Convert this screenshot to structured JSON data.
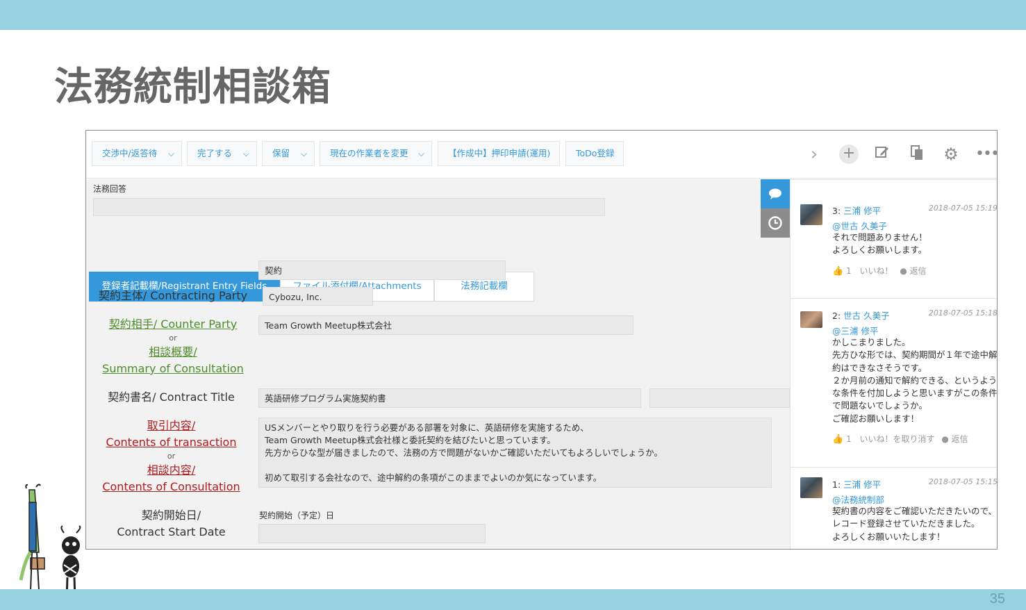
{
  "slide": {
    "title": "法務統制相談箱",
    "page_number": "35"
  },
  "toolbar": {
    "buttons": [
      {
        "label": "交渉中/返答待",
        "has_dropdown": true
      },
      {
        "label": "完了する",
        "has_dropdown": true
      },
      {
        "label": "保留",
        "has_dropdown": true
      },
      {
        "label": "現在の作業者を変更",
        "has_dropdown": true
      },
      {
        "label": "【作成中】押印申請(運用)",
        "has_dropdown": false
      },
      {
        "label": "ToDo登録",
        "has_dropdown": false
      }
    ],
    "icons": [
      "chevron-right-icon",
      "plus-icon",
      "edit-icon",
      "copy-icon",
      "gear-icon",
      "more-icon"
    ]
  },
  "form": {
    "legal_answer_label": "法務回答",
    "legal_answer_value": "",
    "tabs": [
      {
        "label": "登録者記載欄/Registrant Entry Fields",
        "active": true
      },
      {
        "label": "ファイル添付欄/Attachments",
        "active": false
      },
      {
        "label": "法務記載欄",
        "active": false
      }
    ],
    "category_value": "契約",
    "contracting_party_label": "契約主体/ Contracting Party",
    "contracting_party_value": "Cybozu, Inc.",
    "counter_party_label": "契約相手/ Counter Party",
    "or": "or",
    "summary_label_1": "相談概要/",
    "summary_label_2": "Summary of Consultation",
    "counter_party_value": "Team Growth Meetup株式会社",
    "contract_title_label": "契約書名/ Contract Title",
    "contract_title_value": "英語研修プログラム実施契約書",
    "contract_title_extra": "",
    "transaction_label_1": "取引内容/",
    "transaction_label_2": "Contents of transaction",
    "consultation_label_1": "相談内容/",
    "consultation_label_2": "Contents of Consultation",
    "transaction_value": "USメンバーとやり取りを行う必要がある部署を対象に、英語研修を実施するため、\nTeam Growth Meetup株式会社様と委託契約を結びたいと思っています。\n先方からひな型が届きましたので、法務の方で問題がないかご確認いただいてもよろしいでしょうか。\n\n初めて取引する会社なので、途中解約の条項がこのままでよいのか気になっています。",
    "start_date_label_1": "契約開始日/",
    "start_date_label_2": "Contract Start Date",
    "start_date_field_label": "契約開始（予定）日",
    "start_date_value": ""
  },
  "comments": [
    {
      "number": "3:",
      "author": "三浦 修平",
      "date": "2018-07-05 15:19",
      "mention": "@世古 久美子",
      "body": "それで問題ありません！\nよろしくお願いします。",
      "likes": "1",
      "like_label": "いいね！",
      "reply_label": "返信"
    },
    {
      "number": "2:",
      "author": "世古 久美子",
      "date": "2018-07-05 15:18",
      "mention": "@三浦 修平",
      "body": "かしこまりました。\n先方ひな形では、契約期間が１年で途中解約はできなさそうです。\n２か月前の通知で解約できる、というような条件を付加しようと思いますがこの条件で問題ないでしょうか。\nご確認お願いします！",
      "likes": "1",
      "like_label": "いいね！を取り消す",
      "reply_label": "返信"
    },
    {
      "number": "1:",
      "author": "三浦 修平",
      "date": "2018-07-05 15:15",
      "mention": "@法務統制部",
      "body": "契約書の内容をご確認いただきたいので、\nレコード登録させていただきました。\nよろしくお願いいたします！"
    }
  ],
  "colors": {
    "accent": "#3498db",
    "bar": "#98d2e1",
    "title_gray": "#666666"
  }
}
